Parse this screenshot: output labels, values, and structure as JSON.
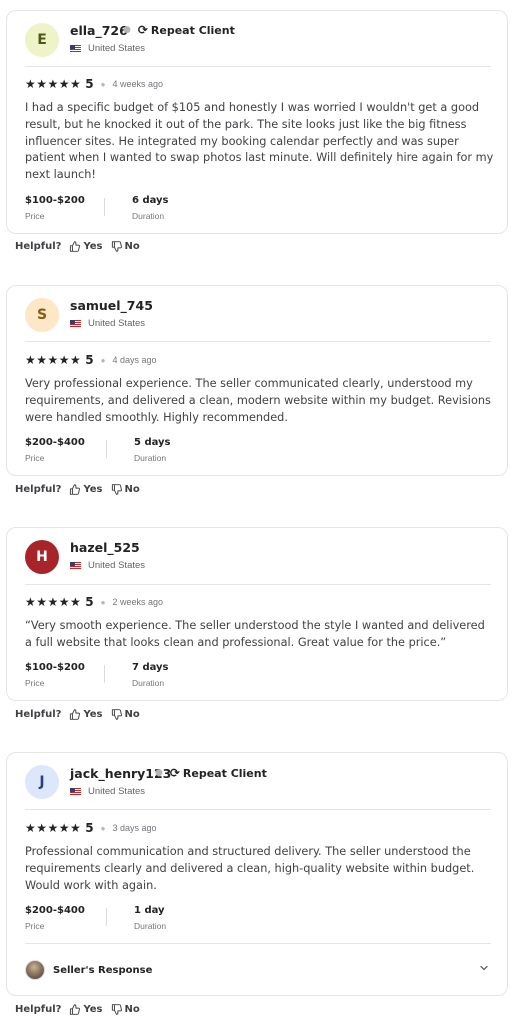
{
  "helpful_label": "Helpful?",
  "yes_label": "Yes",
  "no_label": "No",
  "price_label": "Price",
  "duration_label": "Duration",
  "stars": "★★★★★",
  "reviews": [
    {
      "initial": "E",
      "username": "ella_726",
      "repeat_client": "Repeat Client",
      "country": "United States",
      "score": "5",
      "date": "4 weeks ago",
      "text": "I had a specific budget of $105 and honestly I was worried I wouldn't get a good result, but he knocked it out of the park. The site looks just like the big fitness influencer sites. He integrated my booking calendar perfectly and was super patient when I wanted to swap photos last minute. Will definitely hire again for my next launch!",
      "price": "$100-$200",
      "duration": "6 days",
      "avatar_bg": "#eef3c8",
      "avatar_fg": "#4a5a14"
    },
    {
      "initial": "S",
      "username": "samuel_745",
      "country": "United States",
      "score": "5",
      "date": "4 days ago",
      "text": "Very professional experience. The seller communicated clearly, understood my requirements, and delivered a clean, modern website within my budget. Revisions were handled smoothly. Highly recommended.",
      "price": "$200-$400",
      "duration": "5 days",
      "avatar_bg": "#fde7c7",
      "avatar_fg": "#8a5a12"
    },
    {
      "initial": "H",
      "username": "hazel_525",
      "country": "United States",
      "score": "5",
      "date": "2 weeks ago",
      "text": "“Very smooth experience. The seller understood the style I wanted and delivered a full website that looks clean and professional. Great value for the price.”",
      "price": "$100-$200",
      "duration": "7 days",
      "avatar_bg": "#a8242a",
      "avatar_fg": "#ffffff"
    },
    {
      "initial": "J",
      "username": "jack_henry123",
      "repeat_client": "Repeat Client",
      "country": "United States",
      "score": "5",
      "date": "3 days ago",
      "text": "Professional communication and structured delivery. The seller understood the requirements clearly and delivered a clean, high-quality website within budget. Would work with again.",
      "price": "$200-$400",
      "duration": "1 day",
      "avatar_bg": "#dde6fb",
      "avatar_fg": "#2b3f7a",
      "seller_response_label": "Seller's Response"
    }
  ]
}
